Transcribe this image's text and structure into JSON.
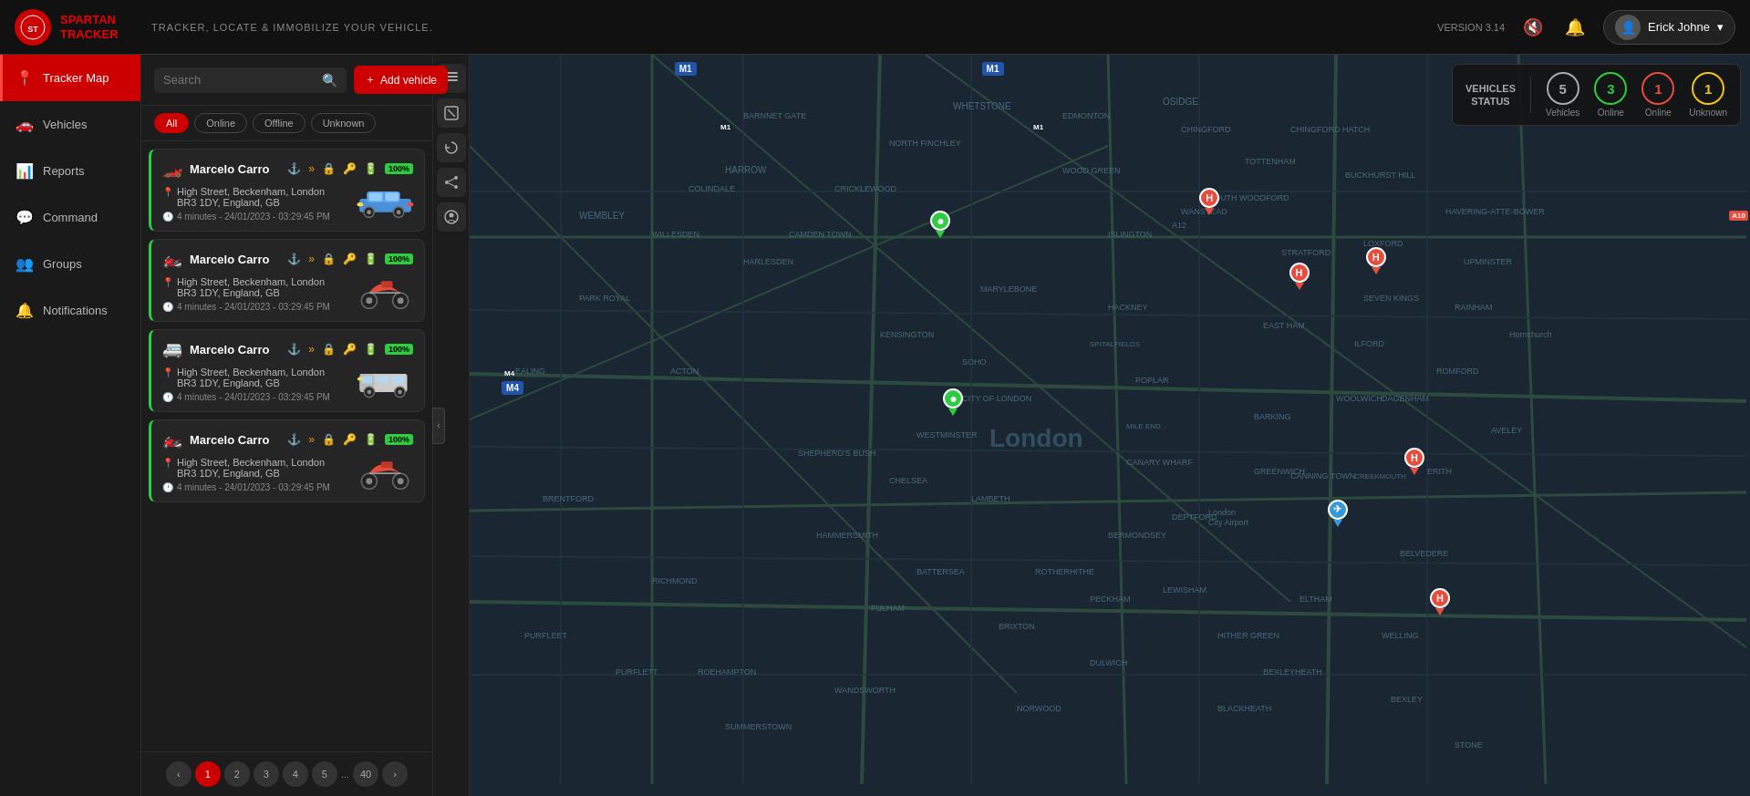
{
  "app": {
    "name": "SPARTAN\nTRACKER",
    "tagline": "TRACKER, LOCATE & IMMOBILIZE YOUR VEHICLE.",
    "version": "VERSION 3.14"
  },
  "header": {
    "user_name": "Erick Johne",
    "mute_icon": "🔇",
    "bell_icon": "🔔",
    "user_icon": "👤",
    "chevron_icon": "▾"
  },
  "sidebar": {
    "items": [
      {
        "label": "Tracker Map",
        "icon": "📍",
        "active": true
      },
      {
        "label": "Vehicles",
        "icon": "🚗",
        "active": false
      },
      {
        "label": "Reports",
        "icon": "📊",
        "active": false
      },
      {
        "label": "Command",
        "icon": "💬",
        "active": false
      },
      {
        "label": "Groups",
        "icon": "👥",
        "active": false
      },
      {
        "label": "Notifications",
        "icon": "🔔",
        "active": false
      }
    ]
  },
  "panel": {
    "search_placeholder": "Search",
    "add_vehicle_label": "+ Add vehicle",
    "filters": [
      {
        "label": "All",
        "active": true
      },
      {
        "label": "Online",
        "active": false
      },
      {
        "label": "Offline",
        "active": false
      },
      {
        "label": "Unknown",
        "active": false
      }
    ]
  },
  "vehicles": [
    {
      "name": "Marcelo Carro",
      "type": "car",
      "status": "online",
      "address_line1": "High Street, Beckenham, London",
      "address_line2": "BR3 1DY, England, GB",
      "time": "4 minutes - 24/01/2023 - 03:29:45 PM",
      "battery": "100%",
      "color_icon": "🔴"
    },
    {
      "name": "Marcelo Carro",
      "type": "moto",
      "status": "online",
      "address_line1": "High Street, Beckenham, London",
      "address_line2": "BR3 1DY, England, GB",
      "time": "4 minutes - 24/01/2023 - 03:29:45 PM",
      "battery": "100%",
      "color_icon": "🟢"
    },
    {
      "name": "Marcelo Carro",
      "type": "van",
      "status": "online",
      "address_line1": "High Street, Beckenham, London",
      "address_line2": "BR3 1DY, England, GB",
      "time": "4 minutes - 24/01/2023 - 03:29:45 PM",
      "battery": "100%",
      "color_icon": "🟡"
    },
    {
      "name": "Marcelo Carro",
      "type": "moto",
      "status": "online",
      "address_line1": "High Street, Beckenham, London",
      "address_line2": "BR3 1DY, England, GB",
      "time": "4 minutes - 24/01/2023 - 03:29:45 PM",
      "battery": "100%",
      "color_icon": "🟢"
    }
  ],
  "pagination": {
    "pages": [
      "1",
      "2",
      "3",
      "4",
      "5",
      "...",
      "40"
    ],
    "active_page": "1"
  },
  "vehicles_status": {
    "label": "VEHICLES\nSTATUS",
    "total": {
      "count": "5",
      "label": "Vehicles"
    },
    "online": {
      "count": "3",
      "label": "Online"
    },
    "offline": {
      "count": "1",
      "label": "Online"
    },
    "unknown": {
      "count": "1",
      "label": "Unknown"
    }
  },
  "map_tools": [
    {
      "icon": "⊞",
      "name": "layers-icon"
    },
    {
      "icon": "⊡",
      "name": "route-icon"
    },
    {
      "icon": "↻",
      "name": "refresh-icon"
    },
    {
      "icon": "⇧",
      "name": "share-icon"
    },
    {
      "icon": "🎧",
      "name": "audio-icon"
    }
  ],
  "map_pins": [
    {
      "x": "57%",
      "y": "20%",
      "color": "red",
      "label": "H"
    },
    {
      "x": "64%",
      "y": "30%",
      "color": "red",
      "label": "H"
    },
    {
      "x": "68%",
      "y": "27%",
      "color": "red",
      "label": "H"
    },
    {
      "x": "72%",
      "y": "56%",
      "color": "red",
      "label": "H"
    },
    {
      "x": "74%",
      "y": "73%",
      "color": "red",
      "label": "H"
    },
    {
      "x": "36%",
      "y": "25%",
      "color": "green",
      "label": "●"
    },
    {
      "x": "35%",
      "y": "46%",
      "color": "green",
      "label": "●"
    },
    {
      "x": "68%",
      "y": "62%",
      "color": "blue",
      "label": "✈"
    }
  ]
}
